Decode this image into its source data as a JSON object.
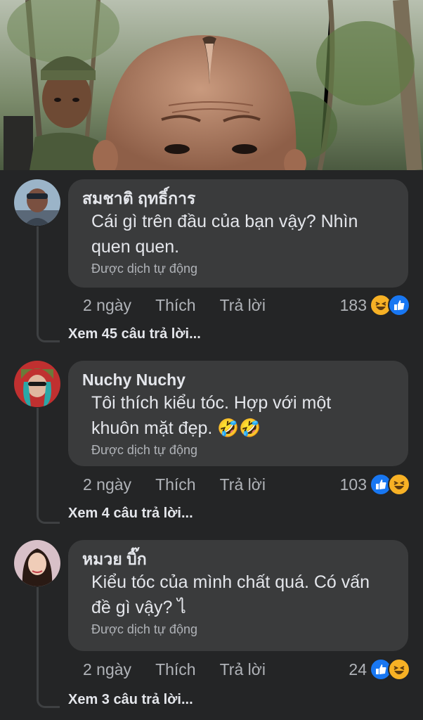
{
  "comments": [
    {
      "author": "สมชาติ ฤทธิ์การ",
      "text_lines": [
        "Cái gì trên đầu của bạn vậy? Nhìn",
        "quen quen."
      ],
      "translated": "Được dịch tự động",
      "time": "2 ngày",
      "like_label": "Thích",
      "reply_label": "Trả lời",
      "reaction_count": "183",
      "reactions": [
        "haha",
        "like"
      ],
      "view_replies": "Xem 45 câu trả lời..."
    },
    {
      "author": "Nuchy Nuchy",
      "text_lines": [
        "Tôi thích kiểu tóc. Hợp với một",
        "khuôn mặt đẹp. 🤣🤣"
      ],
      "translated": "Được dịch tự động",
      "time": "2 ngày",
      "like_label": "Thích",
      "reply_label": "Trả lời",
      "reaction_count": "103",
      "reactions": [
        "like",
        "haha"
      ],
      "view_replies": "Xem 4 câu trả lời..."
    },
    {
      "author": "หมวย บิ๊ก",
      "text_lines": [
        "Kiểu tóc của mình chất quá. Có vấn",
        "đề gì vậy? ไ"
      ],
      "translated": "Được dịch tự động",
      "time": "2 ngày",
      "like_label": "Thích",
      "reply_label": "Trả lời",
      "reaction_count": "24",
      "reactions": [
        "like",
        "haha"
      ],
      "view_replies": "Xem 3 câu trả lời..."
    }
  ],
  "colors": {
    "background": "#242526",
    "bubble": "#3a3b3c",
    "secondary_text": "#b0b3b8",
    "like_blue": "#1877f2",
    "haha_yellow": "#f7b125"
  }
}
